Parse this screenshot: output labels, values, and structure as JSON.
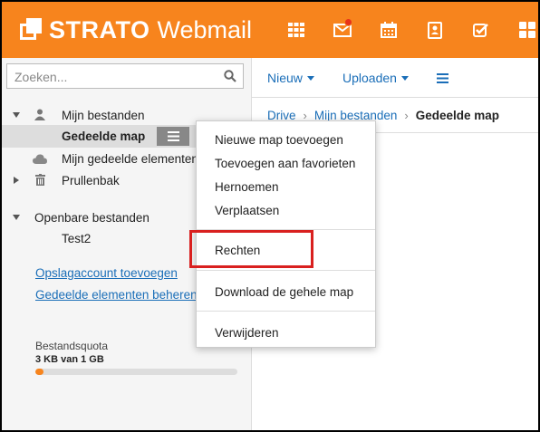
{
  "app": {
    "brand_bold": "STRATO",
    "brand_light": "Webmail",
    "brand_color": "#f7841d"
  },
  "topbar_icons": [
    "grid-icon",
    "mail-icon",
    "calendar-icon",
    "contacts-icon",
    "tasks-icon",
    "apps-icon"
  ],
  "search": {
    "placeholder": "Zoeken..."
  },
  "tree": {
    "my_files": "Mijn bestanden",
    "shared_folder": "Gedeelde map",
    "my_shared": "Mijn gedeelde elementen",
    "trash": "Prullenbak",
    "public_files": "Openbare bestanden",
    "test2": "Test2"
  },
  "links": {
    "add_storage": "Opslagaccount toevoegen",
    "manage_shared": "Gedeelde elementen beheren"
  },
  "quota": {
    "label": "Bestandsquota",
    "value": "3 KB van 1 GB",
    "fraction": 0.04
  },
  "toolbar": {
    "new_label": "Nieuw",
    "upload_label": "Uploaden"
  },
  "breadcrumb": {
    "drive": "Drive",
    "my_files": "Mijn bestanden",
    "current": "Gedeelde map"
  },
  "context_menu": {
    "add_folder": "Nieuwe map toevoegen",
    "add_favorite": "Toevoegen aan favorieten",
    "rename": "Hernoemen",
    "move": "Verplaatsen",
    "rights": "Rechten",
    "download": "Download de gehele map",
    "delete": "Verwijderen"
  },
  "colors": {
    "highlight": "#d9201f",
    "link": "#1a6eb8"
  }
}
